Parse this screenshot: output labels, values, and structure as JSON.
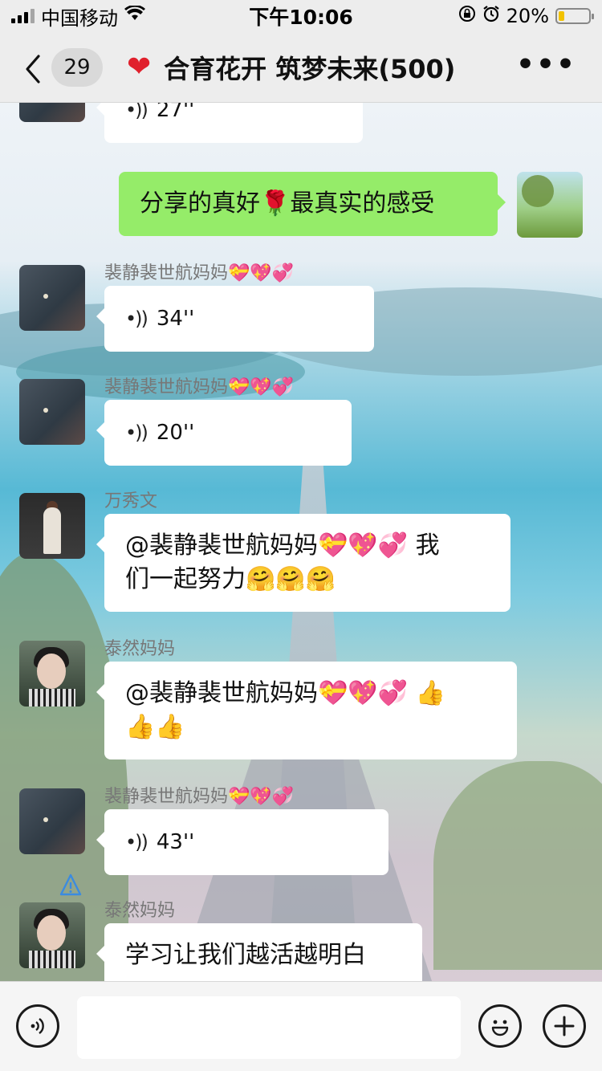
{
  "status_bar": {
    "carrier": "中国移动",
    "time": "下午10:06",
    "battery_percent": "20%",
    "battery_level": 0.2
  },
  "header": {
    "back_label": "<",
    "unread_count": "29",
    "title_icon": "red-heart",
    "title": "合育花开 筑梦未来(500)",
    "more_label": "•••"
  },
  "messages": [
    {
      "type": "voice",
      "side": "left",
      "duration": "27''"
    },
    {
      "type": "text",
      "side": "right",
      "text": "分享的真好🌹最真实的感受"
    },
    {
      "type": "voice",
      "side": "left",
      "sender": "裴静裴世航妈妈💝💖💞",
      "duration": "34''"
    },
    {
      "type": "voice",
      "side": "left",
      "sender": "裴静裴世航妈妈💝💖💞",
      "duration": "20''"
    },
    {
      "type": "text",
      "side": "left",
      "sender": "万秀文",
      "line1": "@裴静裴世航妈妈💝💖💞 我",
      "line2": "们一起努力🤗🤗🤗"
    },
    {
      "type": "text",
      "side": "left",
      "sender": "泰然妈妈",
      "line1": "@裴静裴世航妈妈💝💖💞 👍",
      "line2": "👍👍"
    },
    {
      "type": "voice",
      "side": "left",
      "sender": "裴静裴世航妈妈💝💖💞",
      "duration": "43''"
    },
    {
      "type": "text",
      "side": "left",
      "sender": "泰然妈妈",
      "line1": "学习让我们越活越明白"
    }
  ],
  "input_bar": {
    "voice_icon": "voice-mode-icon",
    "emoji_icon": "emoji-icon",
    "plus_icon": "plus-icon",
    "placeholder": ""
  },
  "colors": {
    "bar_bg": "#ededed",
    "my_bubble": "#95ec69",
    "other_bubble": "#ffffff",
    "heart": "#e0202c",
    "battery": "#f2c200"
  }
}
